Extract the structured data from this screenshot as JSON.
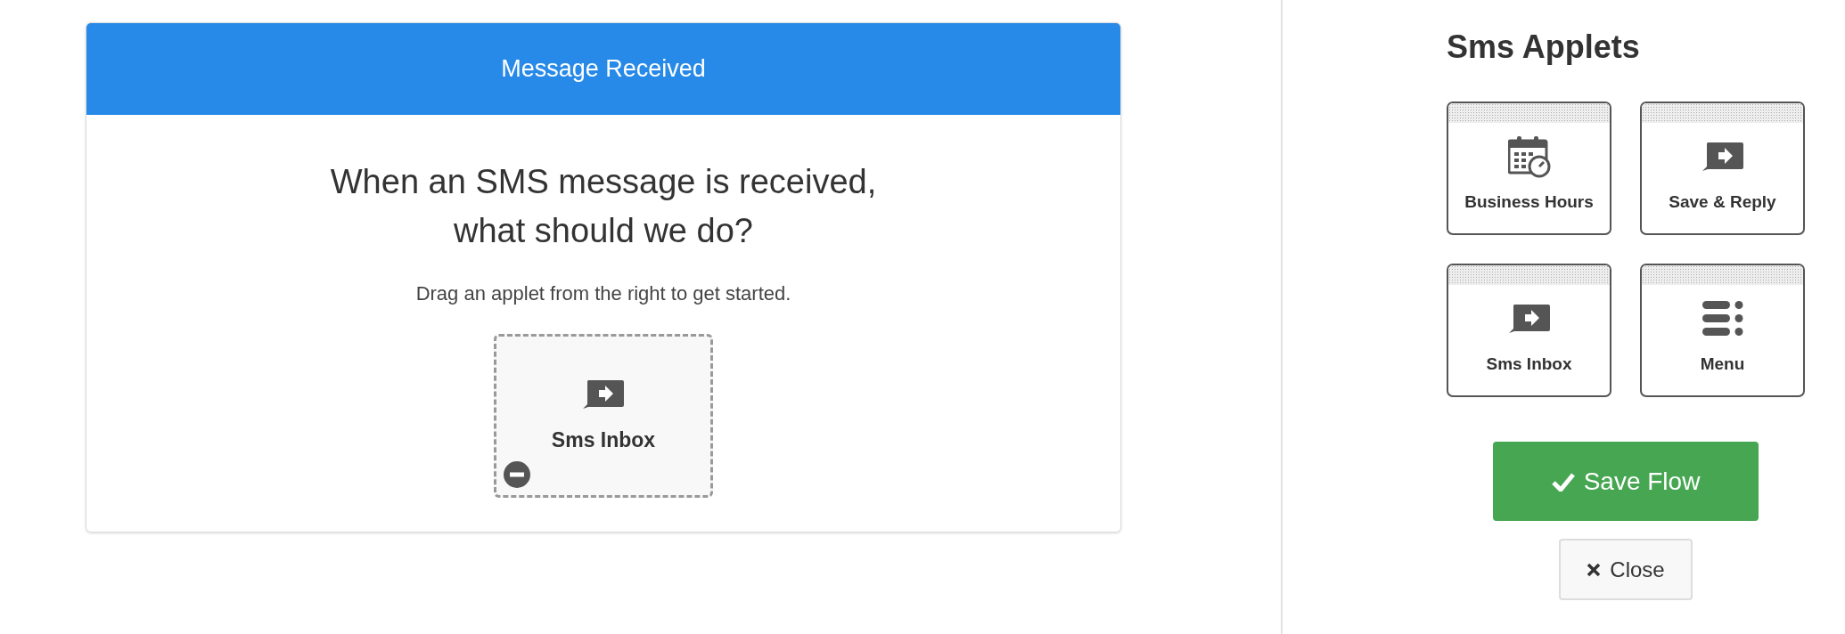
{
  "flow_card": {
    "title": "Message Received",
    "heading_lines": [
      "When an SMS message is received,",
      "what should we do?"
    ],
    "hint": "Drag an applet from the right to get started.",
    "dropped_applet": {
      "label": "Sms Inbox",
      "kind": "chat",
      "removable": true
    }
  },
  "sidebar": {
    "title": "Sms Applets",
    "applets": [
      {
        "label": "Business Hours",
        "kind": "calendar"
      },
      {
        "label": "Save & Reply",
        "kind": "chat"
      },
      {
        "label": "Sms Inbox",
        "kind": "chat"
      },
      {
        "label": "Menu",
        "kind": "menu"
      }
    ],
    "buttons": [
      {
        "label": "Save Flow",
        "kind": "primary"
      },
      {
        "label": "Close",
        "kind": "secondary"
      }
    ]
  }
}
